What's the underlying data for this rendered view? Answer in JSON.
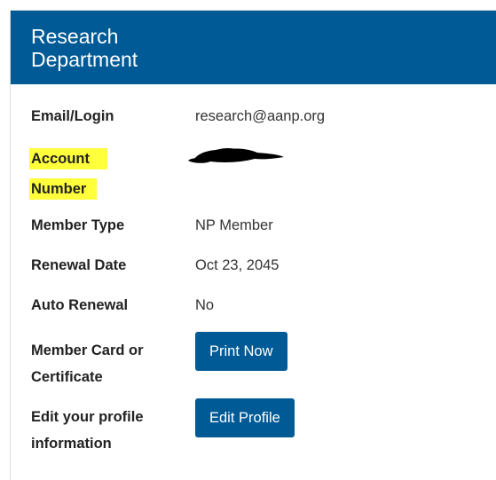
{
  "header": {
    "title": "Research Department"
  },
  "rows": {
    "email": {
      "label": "Email/Login",
      "value": "research@aanp.org"
    },
    "account": {
      "label_line1": "Account",
      "label_line2": "Number",
      "value_redacted": true
    },
    "member_type": {
      "label": "Member Type",
      "value": "NP Member"
    },
    "renewal_date": {
      "label": "Renewal Date",
      "value": "Oct 23, 2045"
    },
    "auto_renewal": {
      "label": "Auto Renewal",
      "value": "No"
    },
    "member_card": {
      "label_line1": "Member Card or",
      "label_line2": "Certificate",
      "button": "Print Now"
    },
    "edit_profile": {
      "label_line1": "Edit your profile",
      "label_line2": "information",
      "button": "Edit Profile"
    }
  },
  "colors": {
    "brand": "#005a96",
    "highlight": "#ffff3c",
    "redaction": "#000000"
  }
}
